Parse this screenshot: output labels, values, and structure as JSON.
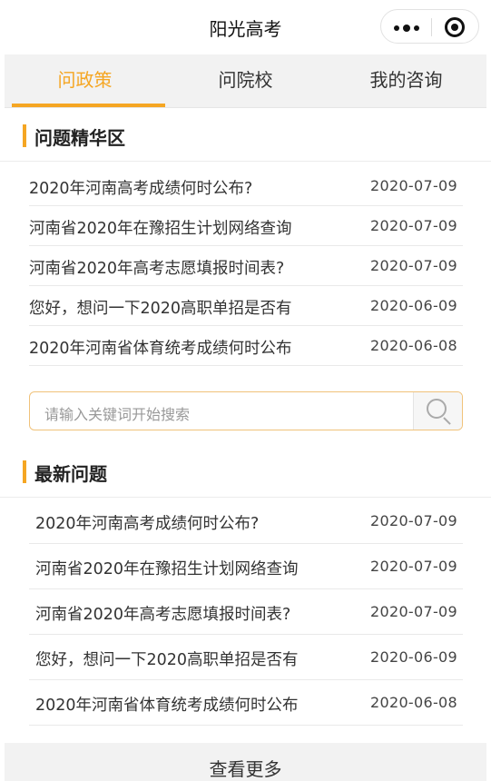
{
  "topbar": {
    "title": "阳光高考"
  },
  "tabs": [
    {
      "label": "问政策",
      "active": true
    },
    {
      "label": "问院校",
      "active": false
    },
    {
      "label": "我的咨询",
      "active": false
    }
  ],
  "featured": {
    "heading": "问题精华区",
    "items": [
      {
        "q": "2020年河南高考成绩何时公布?",
        "date": "2020-07-09"
      },
      {
        "q": "河南省2020年在豫招生计划网络查询",
        "date": "2020-07-09"
      },
      {
        "q": "河南省2020年高考志愿填报时间表?",
        "date": "2020-07-09"
      },
      {
        "q": "您好，想问一下2020高职单招是否有",
        "date": "2020-06-09"
      },
      {
        "q": "2020年河南省体育统考成绩何时公布",
        "date": "2020-06-08"
      }
    ]
  },
  "search": {
    "placeholder": "请输入关键词开始搜索",
    "icon": "search-icon"
  },
  "latest": {
    "heading": "最新问题",
    "items": [
      {
        "q": "2020年河南高考成绩何时公布?",
        "date": "2020-07-09"
      },
      {
        "q": "河南省2020年在豫招生计划网络查询",
        "date": "2020-07-09"
      },
      {
        "q": "河南省2020年高考志愿填报时间表?",
        "date": "2020-07-09"
      },
      {
        "q": "您好，想问一下2020高职单招是否有",
        "date": "2020-06-09"
      },
      {
        "q": "2020年河南省体育统考成绩何时公布",
        "date": "2020-06-08"
      }
    ]
  },
  "more_label": "查看更多",
  "colors": {
    "accent": "#f5a623",
    "tab_bg": "#f2f2f2"
  }
}
